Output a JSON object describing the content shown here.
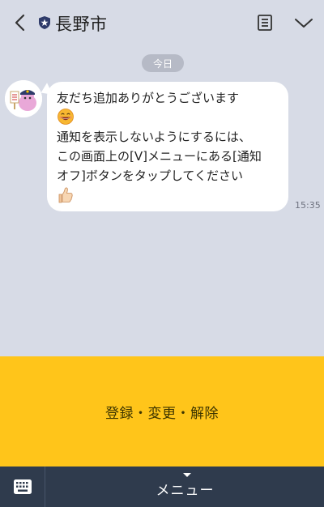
{
  "header": {
    "title": "長野市",
    "back_icon": "chevron-left-icon",
    "badge_icon": "shield-star-icon",
    "notes_icon": "notes-icon",
    "menu_icon": "chevron-down-icon"
  },
  "chat": {
    "date_label": "今日",
    "message": {
      "lines": [
        "友だち追加ありがとうございます",
        "通知を表示しないようにするには、",
        "この画面上の[V]メニューにある[通知",
        "オフ]ボタンをタップしてください"
      ],
      "emoji_1": "grinning-face-emoji",
      "emoji_2": "thumbs-up-emoji",
      "time": "15:35"
    }
  },
  "rich_menu": {
    "button_label": "登録・変更・解除"
  },
  "bottom_bar": {
    "keyboard_icon": "keyboard-icon",
    "menu_label": "メニュー",
    "caret_icon": "caret-down-icon"
  },
  "colors": {
    "background": "#d7dbe6",
    "accent_yellow": "#ffc51a",
    "bottom_bar": "#2f3b4d"
  }
}
